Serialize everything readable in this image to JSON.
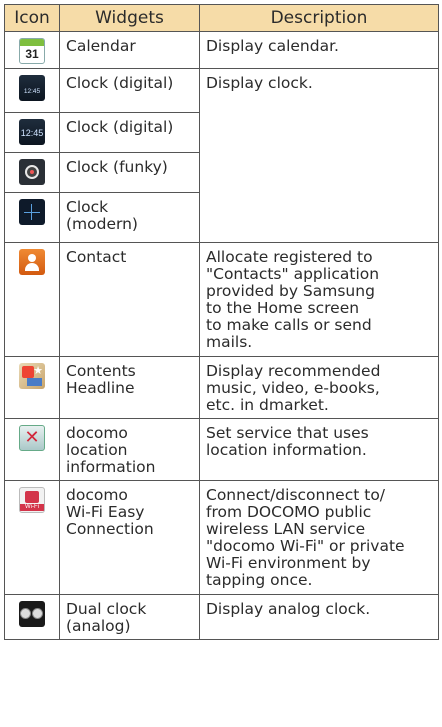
{
  "table": {
    "headers": {
      "icon": "Icon",
      "widgets": "Widgets",
      "description": "Description"
    },
    "rows": [
      {
        "icon": "calendar-icon",
        "icon_text": "31",
        "widget": "Calendar",
        "description": "Display calendar."
      },
      {
        "icon": "clock-digital-icon",
        "icon_text": "12:45",
        "widget": "Clock (digital)",
        "description": "Display clock."
      },
      {
        "icon": "clock-digital-large-icon",
        "icon_text": "12:45",
        "widget": "Clock (digital)"
      },
      {
        "icon": "clock-funky-icon",
        "widget": "Clock (funky)"
      },
      {
        "icon": "clock-modern-icon",
        "widget": "Clock\n(modern)"
      },
      {
        "icon": "contact-icon",
        "widget": "Contact",
        "description": "Allocate registered to\n\"Contacts\" application\nprovided by Samsung\nto the Home screen\nto make calls or send\nmails."
      },
      {
        "icon": "contents-headline-icon",
        "widget": "Contents\nHeadline",
        "description": "Display recommended\nmusic, video, e-books,\netc. in dmarket."
      },
      {
        "icon": "docomo-location-icon",
        "widget": "docomo\nlocation\ninformation",
        "description": "Set service that uses\nlocation information."
      },
      {
        "icon": "docomo-wifi-icon",
        "icon_text": "Wi-Fi",
        "widget": "docomo\nWi-Fi Easy\nConnection",
        "description": "Connect/disconnect to/\nfrom DOCOMO public\nwireless LAN service\n\"docomo Wi-Fi\" or private\nWi-Fi environment by\ntapping once."
      },
      {
        "icon": "dual-clock-icon",
        "widget": "Dual clock\n(analog)",
        "description": "Display analog clock."
      }
    ]
  },
  "colors": {
    "header_bg": "#f6dca8",
    "border": "#555555"
  }
}
